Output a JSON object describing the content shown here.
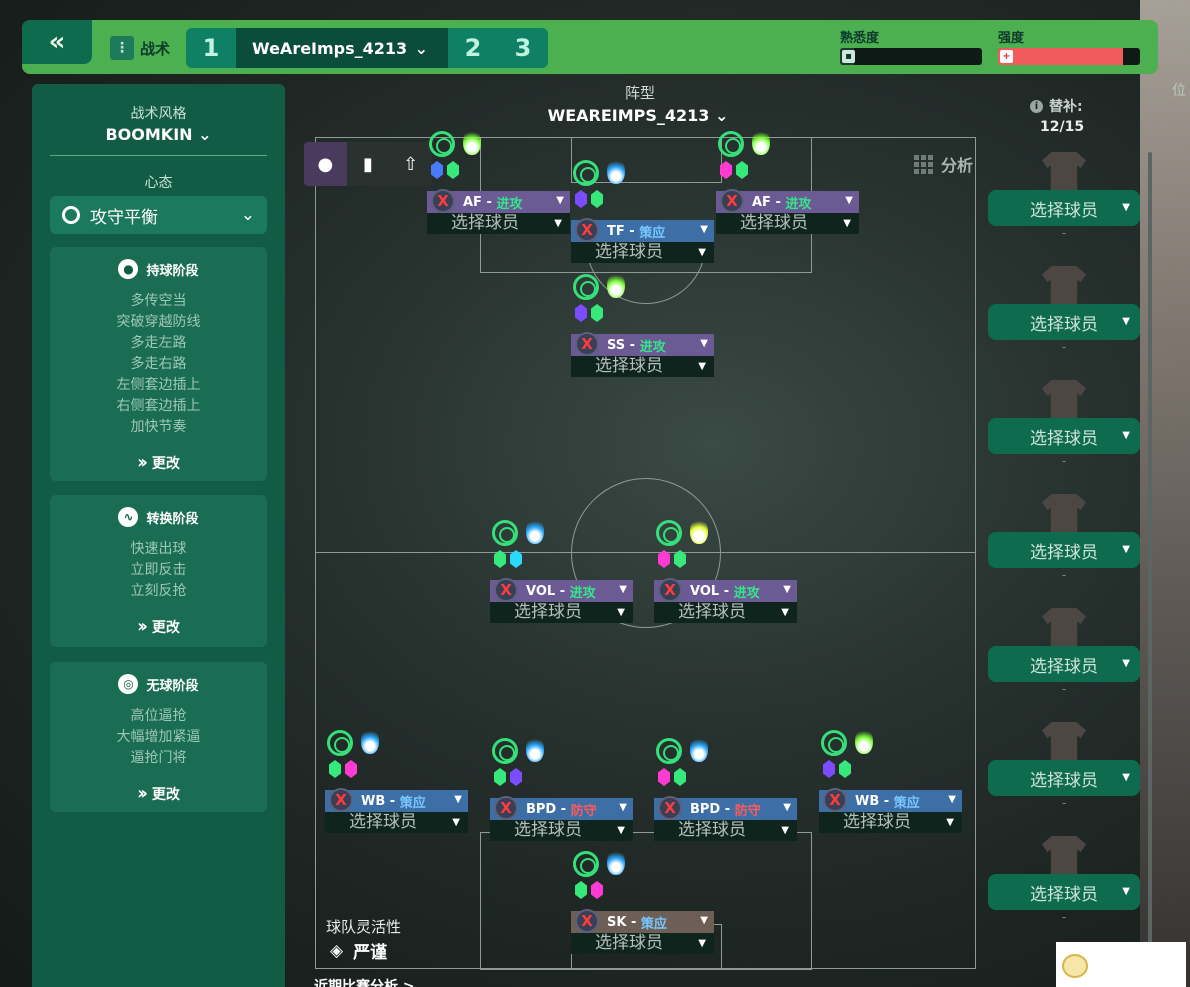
{
  "topbar": {
    "back_icon": "«",
    "tactics_label": "战术",
    "slots": [
      "1",
      "2",
      "3"
    ],
    "active_tactic": "WeAreImps_4213",
    "familiarity_label": "熟悉度",
    "familiarity_level": 0.1,
    "intensity_label": "强度",
    "intensity_level": 0.88,
    "intensity_color": "#f25b5b",
    "familiarity_color": "#4caf50"
  },
  "left": {
    "style_title": "战术风格",
    "style_value": "BOOMKIN",
    "mentality_title": "心态",
    "mentality_value": "攻守平衡",
    "phases": [
      {
        "title": "持球阶段",
        "icon": "ball-icon",
        "items": [
          "多传空当",
          "突破穿越防线",
          "多走左路",
          "多走右路",
          "左侧套边插上",
          "右侧套边插上",
          "加快节奏"
        ],
        "change": "更改"
      },
      {
        "title": "转换阶段",
        "icon": "transition-icon",
        "items": [
          "快速出球",
          "立即反击",
          "立刻反抢"
        ],
        "change": "更改"
      },
      {
        "title": "无球阶段",
        "icon": "shield-ball-icon",
        "items": [
          "高位逼抢",
          "大幅增加紧逼",
          "逼抢门将"
        ],
        "change": "更改"
      }
    ]
  },
  "center": {
    "formation_label": "阵型",
    "formation_value": "WEAREIMPS_4213",
    "analysis_label": "分析",
    "select_player": "选择球员",
    "team_flexibility_title": "球队灵活性",
    "team_flexibility_value": "严谨",
    "recent_label": "近期比赛分析 >"
  },
  "positions": [
    {
      "role": "AF",
      "duty": "进攻",
      "duty_type": "attack",
      "flame": "#7dff3a",
      "hexes": [
        "#4a7bff",
        "#37e87a"
      ]
    },
    {
      "role": "TF",
      "duty": "策应",
      "duty_type": "support",
      "flame": "#2aa8ff",
      "hexes": [
        "#7c4dff",
        "#37e87a"
      ]
    },
    {
      "role": "AF",
      "duty": "进攻",
      "duty_type": "attack",
      "flame": "#7dff3a",
      "hexes": [
        "#ff3bd4",
        "#37e87a"
      ]
    },
    {
      "role": "SS",
      "duty": "进攻",
      "duty_type": "attack",
      "flame": "#7dff3a",
      "hexes": [
        "#7c4dff",
        "#37e87a"
      ]
    },
    {
      "role": "VOL",
      "duty": "进攻",
      "duty_type": "attack",
      "flame": "#2aa8ff",
      "hexes": [
        "#37e87a",
        "#2ad9ff"
      ]
    },
    {
      "role": "VOL",
      "duty": "进攻",
      "duty_type": "attack",
      "flame": "#e6ff3a",
      "hexes": [
        "#ff3bd4",
        "#37e87a"
      ]
    },
    {
      "role": "WB",
      "duty": "策应",
      "duty_type": "support",
      "flame": "#2aa8ff",
      "hexes": [
        "#37e87a",
        "#ff3bd4"
      ]
    },
    {
      "role": "BPD",
      "duty": "防守",
      "duty_type": "defend",
      "flame": "#2aa8ff",
      "hexes": [
        "#37e87a",
        "#7c4dff"
      ]
    },
    {
      "role": "BPD",
      "duty": "防守",
      "duty_type": "defend",
      "flame": "#2aa8ff",
      "hexes": [
        "#ff3bd4",
        "#37e87a"
      ]
    },
    {
      "role": "WB",
      "duty": "策应",
      "duty_type": "support",
      "flame": "#7dff3a",
      "hexes": [
        "#7c4dff",
        "#37e87a"
      ]
    },
    {
      "role": "SK",
      "duty": "策应",
      "duty_type": "support",
      "flame": "#2aa8ff",
      "hexes": [
        "#37e87a",
        "#ff3bd4"
      ]
    }
  ],
  "subs": {
    "label": "替补:",
    "count": "12/15",
    "select_label": "选择球员",
    "dash": "-",
    "position_header": "位"
  }
}
